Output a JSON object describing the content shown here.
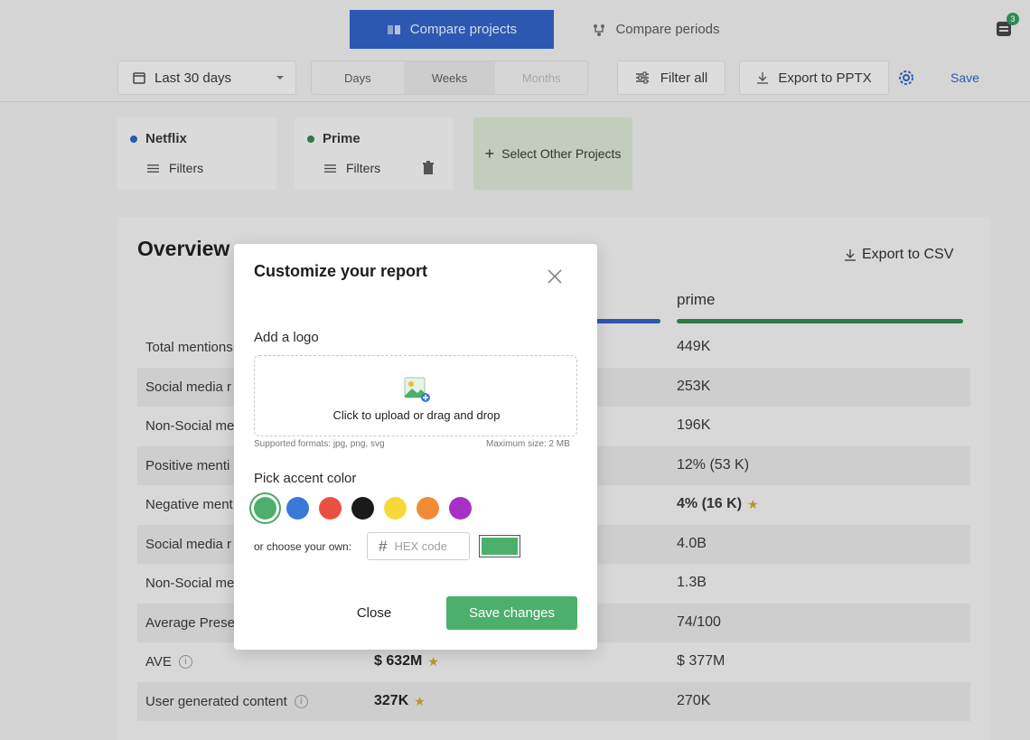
{
  "header": {
    "mode_tabs": [
      {
        "label": "Compare projects",
        "icon": "compare-projects-icon",
        "active": true
      },
      {
        "label": "Compare periods",
        "icon": "compare-periods-icon",
        "active": false
      }
    ],
    "notification_count": "3",
    "date_range": "Last 30 days",
    "granularity": [
      "Days",
      "Weeks",
      "Months"
    ],
    "granularity_selected": "Weeks",
    "filter_all": "Filter all",
    "export_pptx": "Export to PPTX",
    "save": "Save"
  },
  "projects": [
    {
      "name": "Netflix",
      "color": "#2c58b2",
      "filters": "Filters"
    },
    {
      "name": "Prime",
      "color": "#2e7a47",
      "filters": "Filters"
    }
  ],
  "select_other": "Select Other Projects",
  "overview": {
    "title": "Overview",
    "export_csv": "Export to CSV",
    "column_prime": "prime",
    "rows": [
      {
        "label": "Total mentions",
        "netflix": "",
        "prime": "449K"
      },
      {
        "label": "Social media r",
        "netflix": "",
        "prime": "253K"
      },
      {
        "label": "Non-Social me",
        "netflix": "",
        "prime": "196K"
      },
      {
        "label": "Positive menti",
        "netflix": "",
        "prime": "12% (53 K)"
      },
      {
        "label": "Negative ment",
        "netflix": "",
        "prime": "4% (16 K)"
      },
      {
        "label": "Social media r",
        "netflix": "",
        "prime": "4.0B"
      },
      {
        "label": "Non-Social me",
        "netflix": "",
        "prime": "1.3B"
      },
      {
        "label": "Average Prese",
        "netflix": "",
        "prime": "74/100"
      },
      {
        "label": "AVE",
        "netflix": "$ 632M",
        "prime": "$ 377M"
      },
      {
        "label": "User generated content",
        "netflix": "327K",
        "prime": "270K"
      }
    ]
  },
  "modal": {
    "title": "Customize your report",
    "add_logo": "Add a logo",
    "upload_text": "Click to upload or drag and drop",
    "formats": "Supported formats: jpg, png, svg",
    "max_size": "Maximum size: 2 MB",
    "pick_accent": "Pick accent color",
    "swatches": [
      "#4caf6b",
      "#3b78d8",
      "#e8503f",
      "#1a1a1a",
      "#f5d93a",
      "#f08c35",
      "#a630c8"
    ],
    "selected_swatch": "#4caf6b",
    "choose_own": "or choose your own:",
    "hex_placeholder": "HEX code",
    "close": "Close",
    "save_changes": "Save changes"
  }
}
